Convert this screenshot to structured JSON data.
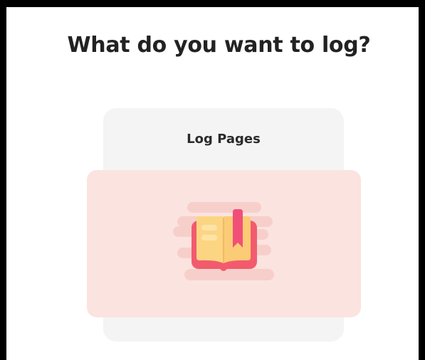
{
  "header": {
    "title": "What do you want to log?"
  },
  "option_card": {
    "label": "Log Pages",
    "icon": "open-book-icon"
  },
  "colors": {
    "card_background": "#f4f4f4",
    "highlight_background": "#fbe3e0",
    "book_cover": "#f25b6e",
    "book_pages": "#fcd583",
    "bookmark": "#f24f78"
  }
}
